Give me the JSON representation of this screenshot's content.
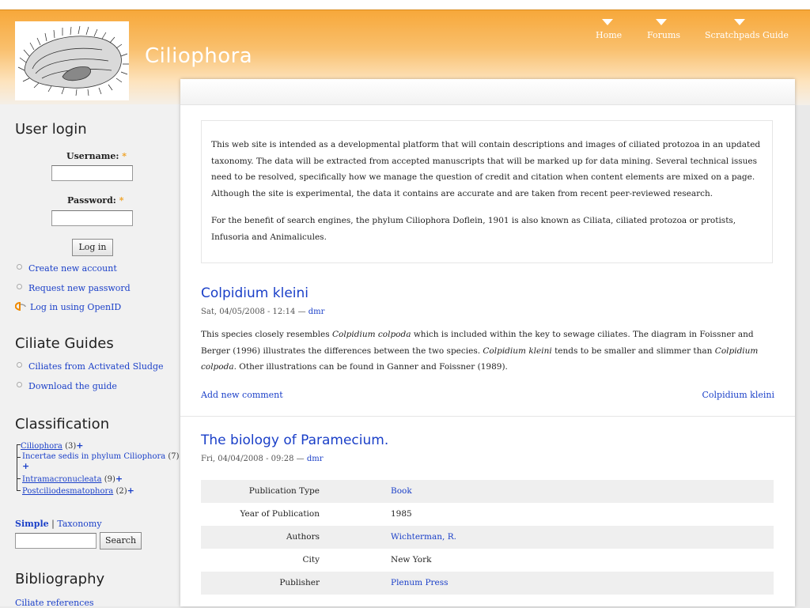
{
  "site": {
    "name": "Ciliophora",
    "nav": [
      {
        "label": "Home"
      },
      {
        "label": "Forums"
      },
      {
        "label": "Scratchpads Guide"
      }
    ]
  },
  "sidebar": {
    "login": {
      "title": "User login",
      "username_label": "Username:",
      "password_label": "Password:",
      "required_mark": "*",
      "login_button": "Log in",
      "links": [
        "Create new account",
        "Request new password",
        "Log in using OpenID"
      ]
    },
    "guides": {
      "title": "Ciliate Guides",
      "links": [
        "Ciliates from Activated Sludge",
        "Download the guide"
      ]
    },
    "classification": {
      "title": "Classification",
      "items": [
        {
          "name": "Ciliophora",
          "count": "(3)"
        },
        {
          "name": "Incertae sedis in phylum Ciliophora",
          "count": "(7)"
        },
        {
          "name": "Intramacronucleata",
          "count": "(9)"
        },
        {
          "name": "Postciliodesmatophora",
          "count": "(2)"
        }
      ],
      "search_modes": {
        "simple": "Simple",
        "divider": "|",
        "taxonomy": "Taxonomy"
      },
      "search_button": "Search"
    },
    "bibliography": {
      "title": "Bibliography",
      "links": [
        "Ciliate references"
      ]
    }
  },
  "main": {
    "intro_p1": "This web site is intended as a developmental platform that will contain descriptions and images of ciliated protozoa in an updated taxonomy. The data will be extracted from accepted manuscripts that will be marked up for data mining. Several technical issues need to be resolved, specifically how we manage the question of credit and citation when content elements are mixed on a page. Although the site is experimental, the data it contains are accurate and are taken from recent peer-reviewed research.",
    "intro_p2": "For the benefit of search engines, the phylum Ciliophora Doflein, 1901 is also known as Ciliata, ciliated protozoa or protists, Infusoria and Animalicules.",
    "node1": {
      "title": "Colpidium kleini",
      "date": "Sat, 04/05/2008 - 12:14",
      "dash": "—",
      "author": "dmr",
      "body": {
        "t1": "This species closely resembles ",
        "i1": "Colpidium colpoda",
        "t2": " which is included within the key to sewage ciliates. The diagram in Foissner and Berger (1996) illustrates the differences between the two species. ",
        "i2": "Colpidium kleini",
        "t3": " tends to be smaller and slimmer than ",
        "i3": "Colpidium colpoda",
        "t4": ". Other illustrations can be found in Ganner and Foissner (1989)."
      },
      "add_comment": "Add new comment",
      "tag": "Colpidium kleini"
    },
    "node2": {
      "title": "The biology of Paramecium.",
      "date": "Fri, 04/04/2008 - 09:28",
      "dash": "—",
      "author": "dmr",
      "fields": [
        {
          "key": "Publication Type",
          "value": "Book",
          "link": true
        },
        {
          "key": "Year of Publication",
          "value": "1985",
          "link": false
        },
        {
          "key": "Authors",
          "value": "Wichterman, R.",
          "link": true
        },
        {
          "key": "City",
          "value": "New York",
          "link": false
        },
        {
          "key": "Publisher",
          "value": "Plenum Press",
          "link": true
        }
      ]
    }
  }
}
